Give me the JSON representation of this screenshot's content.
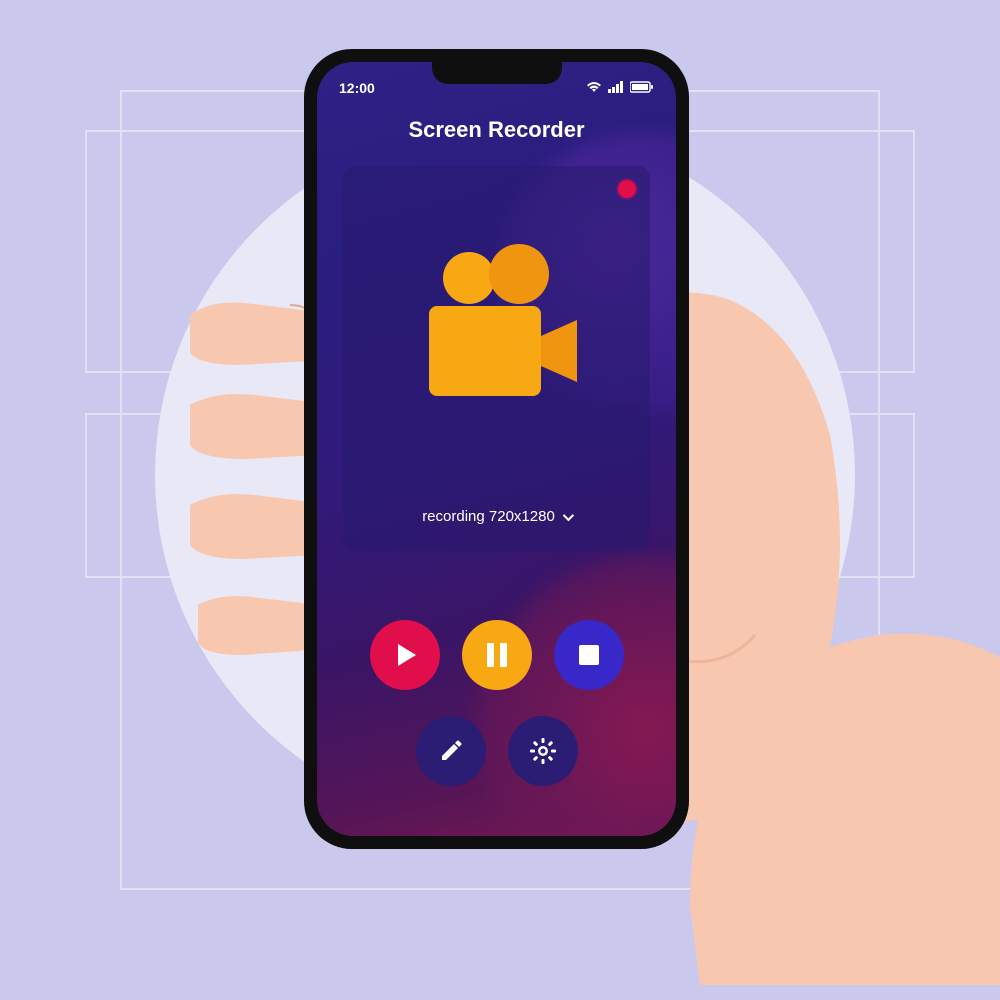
{
  "status": {
    "time": "12:00"
  },
  "app": {
    "title": "Screen Recorder"
  },
  "preview": {
    "resolution_label": "recording 720x1280"
  },
  "icons": {
    "wifi": "wifi-icon",
    "signal": "signal-icon",
    "battery": "battery-icon",
    "record_dot": "record-indicator",
    "camera": "video-camera-icon",
    "play": "play-icon",
    "pause": "pause-icon",
    "stop": "stop-icon",
    "edit": "pencil-icon",
    "settings": "gear-icon",
    "chevron": "chevron-down-icon"
  },
  "colors": {
    "accent_pink": "#e00e4a",
    "accent_orange": "#f7a813",
    "accent_blue": "#3828c9",
    "bg_lavender": "#cac8ed"
  }
}
